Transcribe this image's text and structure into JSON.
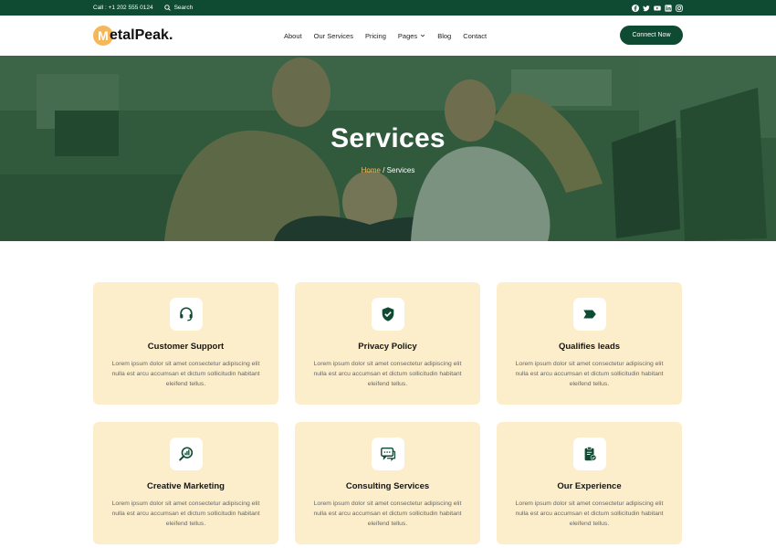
{
  "topbar": {
    "call": "Call : +1 202 555 0124",
    "search_label": "Search",
    "social_icons": [
      "facebook-icon",
      "twitter-icon",
      "youtube-icon",
      "linkedin-icon",
      "instagram-icon"
    ]
  },
  "header": {
    "logo_letter": "M",
    "logo_rest": "etalPeak.",
    "nav": [
      "About",
      "Our Services",
      "Pricing",
      "Pages",
      "Blog",
      "Contact"
    ],
    "cta": "Connect Now"
  },
  "hero": {
    "title": "Services",
    "crumb_home": "Home",
    "crumb_sep": " / ",
    "crumb_current": "Services"
  },
  "services": [
    {
      "title": "Customer Support",
      "icon": "headset-icon",
      "text": "Lorem ipsum dolor sit amet consectetur adipiscing elit nulla est arcu accumsan et dictum sollicitudin habitant eleifend tellus."
    },
    {
      "title": "Privacy Policy",
      "icon": "shield-check-icon",
      "text": "Lorem ipsum dolor sit amet consectetur adipiscing elit nulla est arcu accumsan et dictum sollicitudin habitant eleifend tellus."
    },
    {
      "title": "Qualifies leads",
      "icon": "tag-arrow-icon",
      "text": "Lorem ipsum dolor sit amet consectetur adipiscing elit nulla est arcu accumsan et dictum sollicitudin habitant eleifend tellus."
    },
    {
      "title": "Creative Marketing",
      "icon": "magnifier-chart-icon",
      "text": "Lorem ipsum dolor sit amet consectetur adipiscing elit nulla est arcu accumsan et dictum sollicitudin habitant eleifend tellus."
    },
    {
      "title": "Consulting Services",
      "icon": "chat-bubbles-icon",
      "text": "Lorem ipsum dolor sit amet consectetur adipiscing elit nulla est arcu accumsan et dictum sollicitudin habitant eleifend tellus."
    },
    {
      "title": "Our Experience",
      "icon": "clipboard-check-icon",
      "text": "Lorem ipsum dolor sit amet consectetur adipiscing elit nulla est arcu accumsan et dictum sollicitudin habitant eleifend tellus."
    }
  ],
  "colors": {
    "brand_green": "#0f4a32",
    "accent_orange": "#f6b75a",
    "card_bg": "#fdeecb"
  }
}
